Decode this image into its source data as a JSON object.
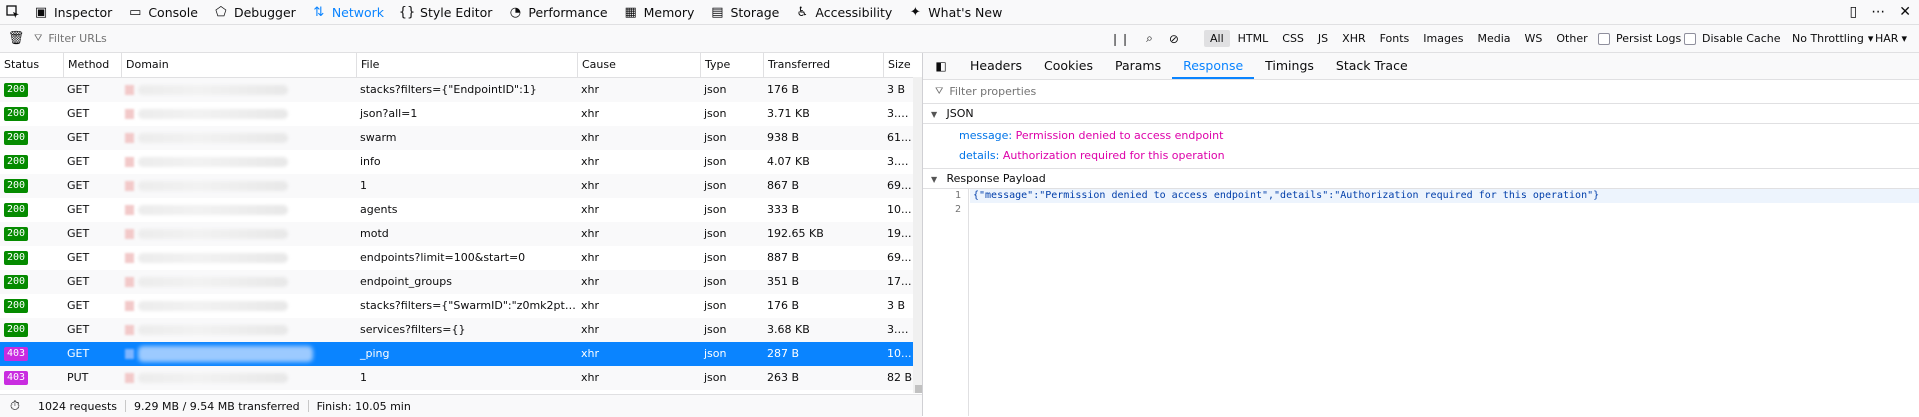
{
  "toolbar": {
    "tabs": [
      {
        "label": "Inspector",
        "icon": "inspector-icon",
        "glyph": "▣"
      },
      {
        "label": "Console",
        "icon": "console-icon",
        "glyph": "▭"
      },
      {
        "label": "Debugger",
        "icon": "debugger-icon",
        "glyph": "⬠"
      },
      {
        "label": "Network",
        "icon": "network-icon",
        "glyph": "⇅"
      },
      {
        "label": "Style Editor",
        "icon": "style-editor-icon",
        "glyph": "{}"
      },
      {
        "label": "Performance",
        "icon": "performance-icon",
        "glyph": "◔"
      },
      {
        "label": "Memory",
        "icon": "memory-icon",
        "glyph": "▦"
      },
      {
        "label": "Storage",
        "icon": "storage-icon",
        "glyph": "▤"
      },
      {
        "label": "Accessibility",
        "icon": "accessibility-icon",
        "glyph": "♿"
      },
      {
        "label": "What's New",
        "icon": "whats-new-icon",
        "glyph": "✦"
      }
    ],
    "active_tab": "Network"
  },
  "filterbar": {
    "placeholder": "Filter URLs",
    "type_filters": [
      "All",
      "HTML",
      "CSS",
      "JS",
      "XHR",
      "Fonts",
      "Images",
      "Media",
      "WS",
      "Other"
    ],
    "active_filter": "All",
    "persist_logs": "Persist Logs",
    "disable_cache": "Disable Cache",
    "throttling": "No Throttling",
    "har": "HAR"
  },
  "table": {
    "headers": [
      "Status",
      "Method",
      "Domain",
      "File",
      "Cause",
      "Type",
      "Transferred",
      "Size"
    ],
    "rows": [
      {
        "status": "200",
        "method": "GET",
        "file": "stacks?filters={\"EndpointID\":1}",
        "cause": "xhr",
        "type": "json",
        "transferred": "176 B",
        "size": "3 B"
      },
      {
        "status": "200",
        "method": "GET",
        "file": "json?all=1",
        "cause": "xhr",
        "type": "json",
        "transferred": "3.71 KB",
        "size": "3.4..."
      },
      {
        "status": "200",
        "method": "GET",
        "file": "swarm",
        "cause": "xhr",
        "type": "json",
        "transferred": "938 B",
        "size": "61..."
      },
      {
        "status": "200",
        "method": "GET",
        "file": "info",
        "cause": "xhr",
        "type": "json",
        "transferred": "4.07 KB",
        "size": "3.7..."
      },
      {
        "status": "200",
        "method": "GET",
        "file": "1",
        "cause": "xhr",
        "type": "json",
        "transferred": "867 B",
        "size": "69..."
      },
      {
        "status": "200",
        "method": "GET",
        "file": "agents",
        "cause": "xhr",
        "type": "json",
        "transferred": "333 B",
        "size": "10..."
      },
      {
        "status": "200",
        "method": "GET",
        "file": "motd",
        "cause": "xhr",
        "type": "json",
        "transferred": "192.65 KB",
        "size": "19..."
      },
      {
        "status": "200",
        "method": "GET",
        "file": "endpoints?limit=100&start=0",
        "cause": "xhr",
        "type": "json",
        "transferred": "887 B",
        "size": "69..."
      },
      {
        "status": "200",
        "method": "GET",
        "file": "endpoint_groups",
        "cause": "xhr",
        "type": "json",
        "transferred": "351 B",
        "size": "17..."
      },
      {
        "status": "200",
        "method": "GET",
        "file": "stacks?filters={\"SwarmID\":\"z0mk2ptcogp...",
        "cause": "xhr",
        "type": "json",
        "transferred": "176 B",
        "size": "3 B"
      },
      {
        "status": "200",
        "method": "GET",
        "file": "services?filters={}",
        "cause": "xhr",
        "type": "json",
        "transferred": "3.68 KB",
        "size": "3.3..."
      },
      {
        "status": "403",
        "method": "GET",
        "file": "_ping",
        "cause": "xhr",
        "type": "json",
        "transferred": "287 B",
        "size": "10...",
        "selected": true
      },
      {
        "status": "403",
        "method": "PUT",
        "file": "1",
        "cause": "xhr",
        "type": "json",
        "transferred": "263 B",
        "size": "82 B"
      }
    ]
  },
  "statusbar": {
    "requests": "1024 requests",
    "transferred": "9.29 MB / 9.54 MB transferred",
    "finish": "Finish: 10.05 min"
  },
  "panel": {
    "tabs": [
      "Headers",
      "Cookies",
      "Params",
      "Response",
      "Timings",
      "Stack Trace"
    ],
    "active_tab": "Response",
    "filter_placeholder": "Filter properties",
    "json_section": "JSON",
    "json": [
      {
        "key": "message:",
        "value": "Permission denied to access endpoint"
      },
      {
        "key": "details:",
        "value": "Authorization required for this operation"
      }
    ],
    "payload_section": "Response Payload",
    "payload_lines": [
      {
        "num": "1",
        "text": "{\"message\":\"Permission denied to access endpoint\",\"details\":\"Authorization required for this operation\"}"
      },
      {
        "num": "2",
        "text": ""
      }
    ]
  },
  "colors": {
    "accent": "#0a84ff",
    "status_ok": "#058b00",
    "status_error": "#c92ce0",
    "json_key": "#0074e8",
    "json_value": "#dd00a9"
  }
}
